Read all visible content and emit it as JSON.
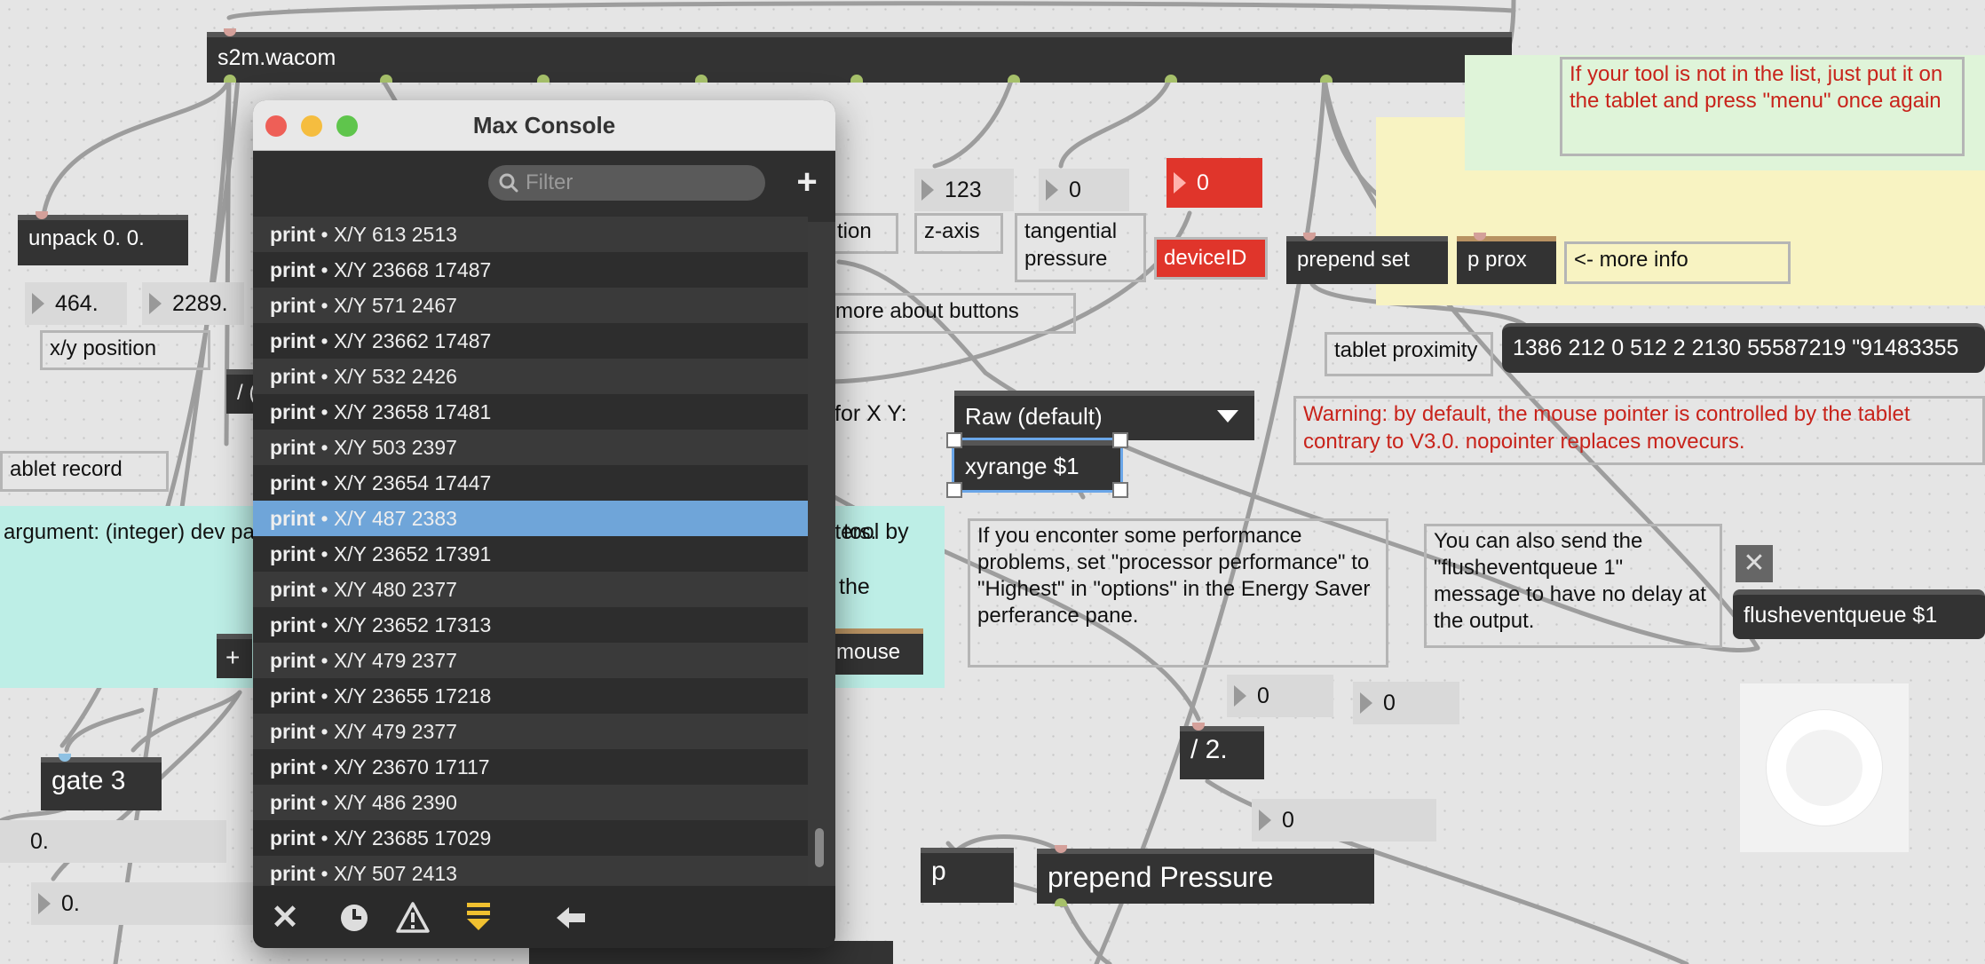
{
  "patch": {
    "s2m_wacom": "s2m.wacom",
    "unpack": "unpack 0. 0.",
    "xy_values": [
      "464.",
      "2289."
    ],
    "xy_label": "x/y position",
    "tablet_record": "ablet record",
    "argument_comment": "argument: (integer) dev passing its deviceID in a configuration and can c mouse parameters.",
    "plus_button": "+",
    "gate": "gate 3",
    "gate_values": [
      "0.",
      "0."
    ],
    "slash_obj": "/ (",
    "tool_by_text": "tool by",
    "the_text": "the",
    "mouse_button": "mouse",
    "tion_label": "tion",
    "z_value": "123",
    "z_label": "z-axis",
    "tang_value": "0",
    "tang_label": "tangential pressure",
    "device_value": "0",
    "device_label": "deviceID",
    "prepend_set": "prepend set",
    "p_prox": "p prox",
    "more_info": "<- more info",
    "tool_note": "If your tool is not in the list, just put it on the tablet and press \"menu\" once again",
    "more_about_buttons": "more about buttons",
    "tablet_proximity": "tablet proximity",
    "proximity_message": "1386 212 0 512 2 2130 55587219 \"91483355",
    "for_xy": "for X Y:",
    "xy_mode": "Raw (default)",
    "xyrange": "xyrange $1",
    "warning": "Warning: by default, the mouse pointer is controlled by the tablet contrary to V3.0. nopointer replaces movecurs.",
    "perf_note": "If you enconter some performance problems, set \"processor performance\" to \"Highest\" in \"options\" in the Energy Saver perferance pane.",
    "flush_note": "You can also send the \"flusheventqueue 1\" message to have no delay at the output.",
    "flush_obj": "flusheventqueue $1",
    "div2": "/ 2.",
    "div_vals": [
      "0",
      "0",
      "0"
    ],
    "p_obj": "p",
    "prepend_pressure": "prepend Pressure"
  },
  "console": {
    "title": "Max Console",
    "filter_placeholder": "Filter",
    "add": "+",
    "rows": [
      {
        "src": "print",
        "msg": "X/Y 613 2513"
      },
      {
        "src": "print",
        "msg": "X/Y 23668 17487"
      },
      {
        "src": "print",
        "msg": "X/Y 571 2467"
      },
      {
        "src": "print",
        "msg": "X/Y 23662 17487"
      },
      {
        "src": "print",
        "msg": "X/Y 532 2426"
      },
      {
        "src": "print",
        "msg": "X/Y 23658 17481"
      },
      {
        "src": "print",
        "msg": "X/Y 503 2397"
      },
      {
        "src": "print",
        "msg": "X/Y 23654 17447"
      },
      {
        "src": "print",
        "msg": "X/Y 487 2383",
        "selected": true
      },
      {
        "src": "print",
        "msg": "X/Y 23652 17391"
      },
      {
        "src": "print",
        "msg": "X/Y 480 2377"
      },
      {
        "src": "print",
        "msg": "X/Y 23652 17313"
      },
      {
        "src": "print",
        "msg": "X/Y 479 2377"
      },
      {
        "src": "print",
        "msg": "X/Y 23655 17218"
      },
      {
        "src": "print",
        "msg": "X/Y 479 2377"
      },
      {
        "src": "print",
        "msg": "X/Y 23670 17117"
      },
      {
        "src": "print",
        "msg": "X/Y 486 2390"
      },
      {
        "src": "print",
        "msg": "X/Y 23685 17029"
      },
      {
        "src": "print",
        "msg": "X/Y 507 2413"
      }
    ],
    "bottom_icons": [
      "close-icon",
      "clock-icon",
      "warning-icon",
      "autoscroll-icon",
      "back-arrow-icon"
    ]
  },
  "colors": {
    "accent_red": "#e0352b",
    "selection": "#6fa5d9",
    "console_bg": "#3b3b3b",
    "patch_bg": "#e5e5e5"
  }
}
